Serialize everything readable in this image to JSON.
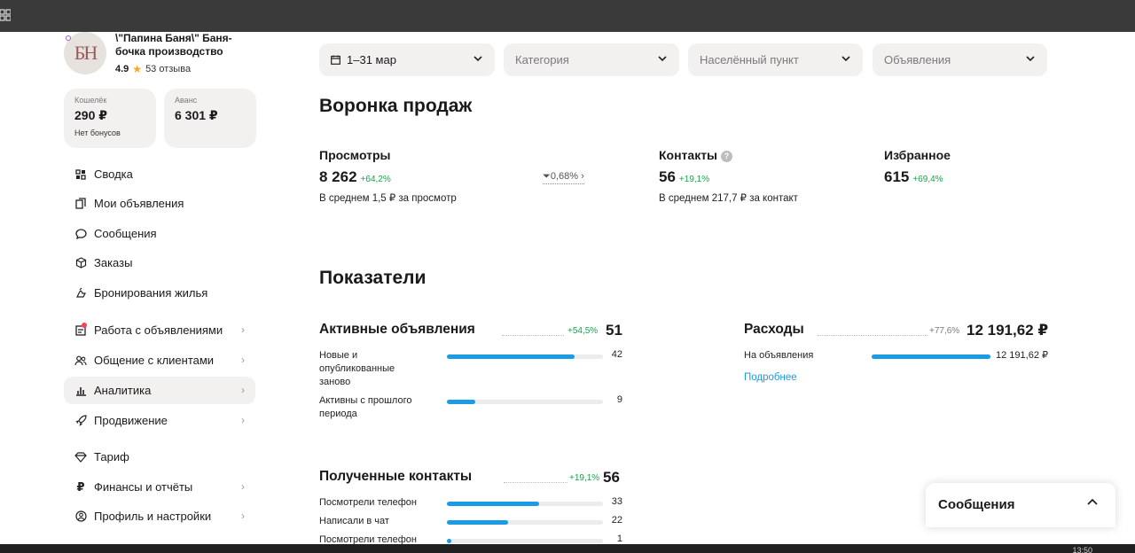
{
  "shop": {
    "avatar_initials": "БН",
    "name": "\\\"Папина Баня\\\" Баня-бочка производство",
    "rating": "4.9",
    "reviews": "53 отзыва"
  },
  "wallet": {
    "label": "Кошелёк",
    "value": "290 ₽",
    "sub": "Нет бонусов"
  },
  "advance": {
    "label": "Аванс",
    "value": "6 301 ₽"
  },
  "nav": [
    {
      "label": "Сводка",
      "icon": "grid-icon"
    },
    {
      "label": "Мои объявления",
      "icon": "copy-icon"
    },
    {
      "label": "Сообщения",
      "icon": "chat-icon"
    },
    {
      "label": "Заказы",
      "icon": "box-icon"
    },
    {
      "label": "Бронирования жилья",
      "icon": "hand-icon"
    },
    {
      "label": "Работа с объявлениями",
      "icon": "tasks-icon",
      "badge": true
    },
    {
      "label": "Общение с клиентами",
      "icon": "users-icon"
    },
    {
      "label": "Аналитика",
      "icon": "chart-icon",
      "active": true
    },
    {
      "label": "Продвижение",
      "icon": "rocket-icon"
    },
    {
      "label": "Тариф",
      "icon": "diamond-icon"
    },
    {
      "label": "Финансы и отчёты",
      "icon": "ruble-icon"
    },
    {
      "label": "Профиль и настройки",
      "icon": "profile-icon"
    }
  ],
  "filters": {
    "date": "1–31 мар",
    "category": "Категория",
    "locality": "Населённый пункт",
    "ads": "Объявления"
  },
  "funnel": {
    "title": "Воронка продаж",
    "views": {
      "title": "Просмотры",
      "value": "8 262",
      "pct": "+64,2%",
      "sub": "В среднем 1,5 ₽ за просмотр"
    },
    "conversion": "0,68%",
    "contacts": {
      "title": "Контакты",
      "value": "56",
      "pct": "+19,1%",
      "sub": "В среднем 217,7 ₽ за контакт"
    },
    "favorites": {
      "title": "Избранное",
      "value": "615",
      "pct": "+69,4%"
    }
  },
  "indicators": {
    "title": "Показатели",
    "active": {
      "title": "Активные объявления",
      "pct": "+54,5%",
      "total": "51",
      "rows": [
        {
          "label": "Новые и опубликованные заново",
          "value": "42",
          "fraction": 0.82
        },
        {
          "label": "Активны с прошлого периода",
          "value": "9",
          "fraction": 0.18
        }
      ]
    },
    "expenses": {
      "title": "Расходы",
      "pct": "+77,6%",
      "total": "12 191,62 ₽",
      "rows": [
        {
          "label": "На объявления",
          "value": "12 191,62 ₽",
          "fraction": 1.0
        }
      ],
      "link": "Подробнее"
    },
    "contacts": {
      "title": "Полученные контакты",
      "pct": "+19,1%",
      "total": "56",
      "rows": [
        {
          "label": "Посмотрели телефон",
          "value": "33",
          "fraction": 0.59
        },
        {
          "label": "Написали в чат",
          "value": "22",
          "fraction": 0.39
        },
        {
          "label": "Посмотрели телефон",
          "value": "1",
          "fraction": 0.03
        }
      ]
    }
  },
  "messages_panel": {
    "title": "Сообщения"
  },
  "taskbar": {
    "time": "13:50"
  }
}
